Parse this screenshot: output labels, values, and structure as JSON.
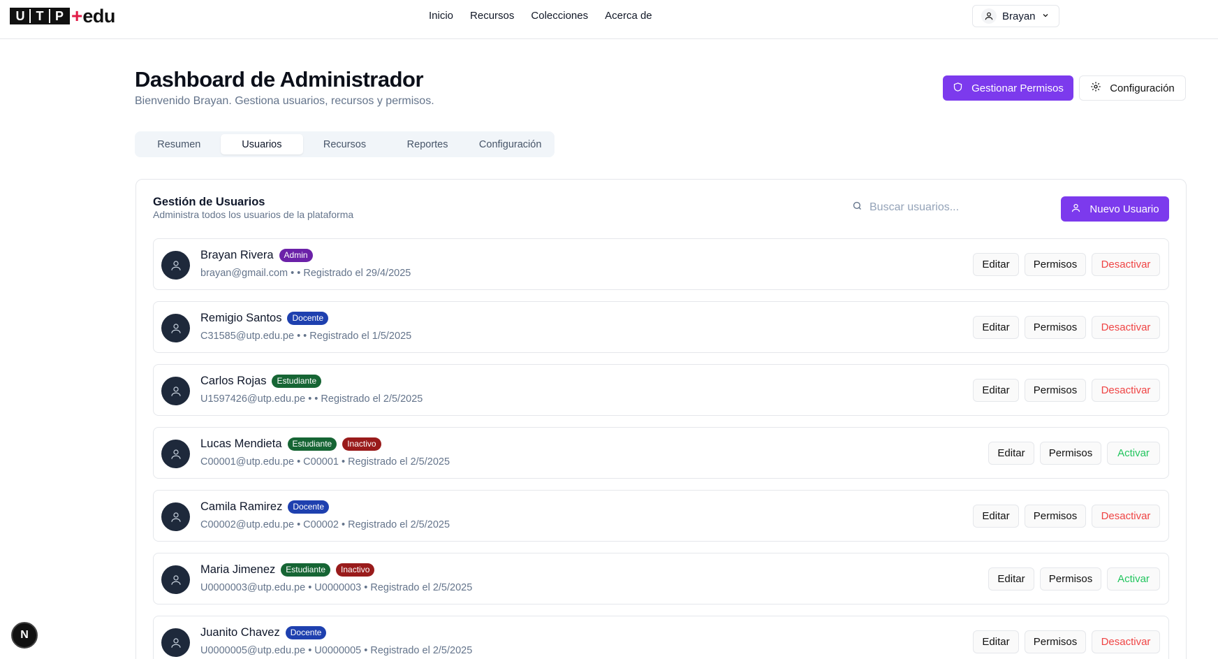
{
  "header": {
    "logo_letters": [
      "U",
      "T",
      "P"
    ],
    "logo_plus": "+",
    "logo_suffix": "edu",
    "nav": [
      "Inicio",
      "Recursos",
      "Colecciones",
      "Acerca de"
    ],
    "user_name": "Brayan"
  },
  "page": {
    "title": "Dashboard de Administrador",
    "subtitle": "Bienvenido Brayan. Gestiona usuarios, recursos y permisos.",
    "manage_permissions_label": "Gestionar Permisos",
    "settings_label": "Configuración"
  },
  "tabs": [
    {
      "label": "Resumen",
      "active": false
    },
    {
      "label": "Usuarios",
      "active": true
    },
    {
      "label": "Recursos",
      "active": false
    },
    {
      "label": "Reportes",
      "active": false
    },
    {
      "label": "Configuración",
      "active": false
    }
  ],
  "users_card": {
    "title": "Gestión de Usuarios",
    "subtitle": "Administra todos los usuarios de la plataforma",
    "search_placeholder": "Buscar usuarios...",
    "new_user_label": "Nuevo Usuario",
    "edit_label": "Editar",
    "permissions_label": "Permisos",
    "deactivate_label": "Desactivar",
    "activate_label": "Activar",
    "users": [
      {
        "name": "Brayan Rivera",
        "badges": [
          {
            "text": "Admin",
            "color": "#6b21a8"
          }
        ],
        "meta": "brayan@gmail.com • • Registrado el 29/4/2025",
        "active": true
      },
      {
        "name": "Remigio Santos",
        "badges": [
          {
            "text": "Docente",
            "color": "#1e40af"
          }
        ],
        "meta": "C31585@utp.edu.pe • • Registrado el 1/5/2025",
        "active": true
      },
      {
        "name": "Carlos Rojas",
        "badges": [
          {
            "text": "Estudiante",
            "color": "#166534"
          }
        ],
        "meta": "U1597426@utp.edu.pe • • Registrado el 2/5/2025",
        "active": true
      },
      {
        "name": "Lucas Mendieta",
        "badges": [
          {
            "text": "Estudiante",
            "color": "#166534"
          },
          {
            "text": "Inactivo",
            "color": "#991b1b"
          }
        ],
        "meta": "C00001@utp.edu.pe • C00001 • Registrado el 2/5/2025",
        "active": false
      },
      {
        "name": "Camila Ramirez",
        "badges": [
          {
            "text": "Docente",
            "color": "#1e40af"
          }
        ],
        "meta": "C00002@utp.edu.pe • C00002 • Registrado el 2/5/2025",
        "active": true
      },
      {
        "name": "Maria Jimenez",
        "badges": [
          {
            "text": "Estudiante",
            "color": "#166534"
          },
          {
            "text": "Inactivo",
            "color": "#991b1b"
          }
        ],
        "meta": "U0000003@utp.edu.pe • U0000003 • Registrado el 2/5/2025",
        "active": false
      },
      {
        "name": "Juanito Chavez",
        "badges": [
          {
            "text": "Docente",
            "color": "#1e40af"
          }
        ],
        "meta": "U0000005@utp.edu.pe • U0000005 • Registrado el 2/5/2025",
        "active": true
      }
    ]
  },
  "dev_badge": "N",
  "colors": {
    "primary": "#7c3aed",
    "danger": "#ef4444",
    "success": "#22c55e"
  }
}
